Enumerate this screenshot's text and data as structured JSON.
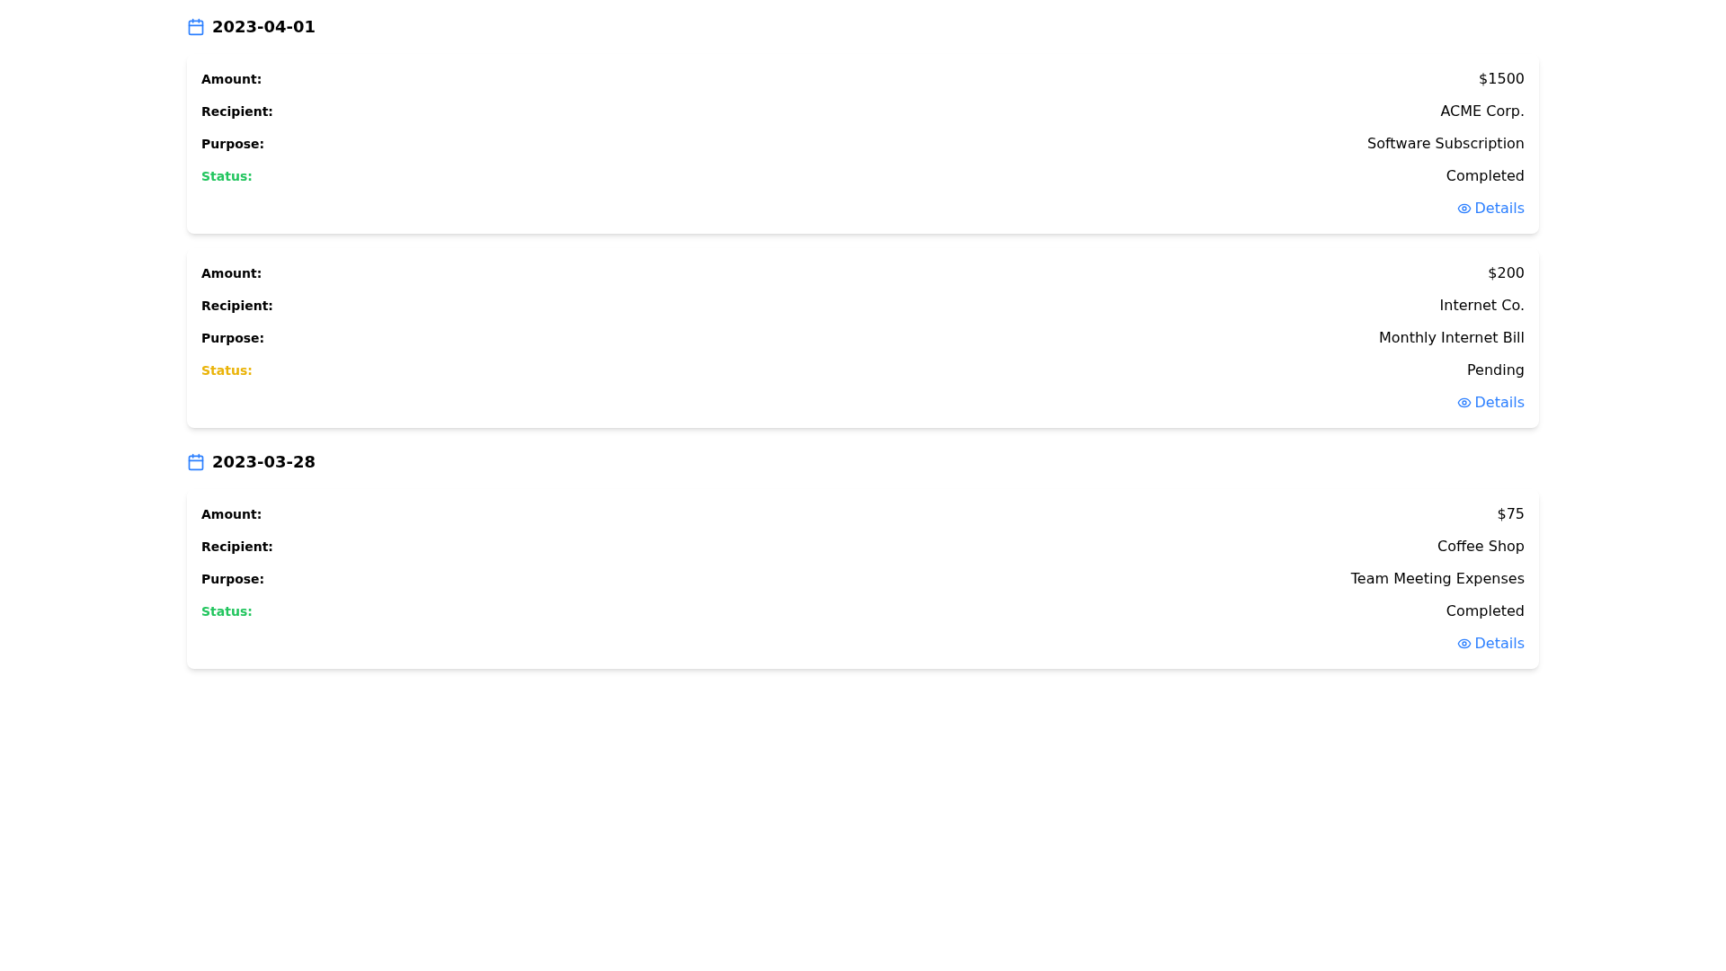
{
  "groups": [
    {
      "date": "2023-04-01",
      "transactions": [
        {
          "fields": [
            {
              "label": "Amount:",
              "value": "$1500"
            },
            {
              "label": "Recipient:",
              "value": "ACME Corp."
            },
            {
              "label": "Purpose:",
              "value": "Software Subscription"
            }
          ],
          "status": {
            "label": "Status:",
            "value": "Completed",
            "color": "#22c55e"
          },
          "action": "Details"
        },
        {
          "fields": [
            {
              "label": "Amount:",
              "value": "$200"
            },
            {
              "label": "Recipient:",
              "value": "Internet Co."
            },
            {
              "label": "Purpose:",
              "value": "Monthly Internet Bill"
            }
          ],
          "status": {
            "label": "Status:",
            "value": "Pending",
            "color": "#eab308"
          },
          "action": "Details"
        }
      ]
    },
    {
      "date": "2023-03-28",
      "transactions": [
        {
          "fields": [
            {
              "label": "Amount:",
              "value": "$75"
            },
            {
              "label": "Recipient:",
              "value": "Coffee Shop"
            },
            {
              "label": "Purpose:",
              "value": "Team Meeting Expenses"
            }
          ],
          "status": {
            "label": "Status:",
            "value": "Completed",
            "color": "#22c55e"
          },
          "action": "Details"
        }
      ]
    }
  ]
}
